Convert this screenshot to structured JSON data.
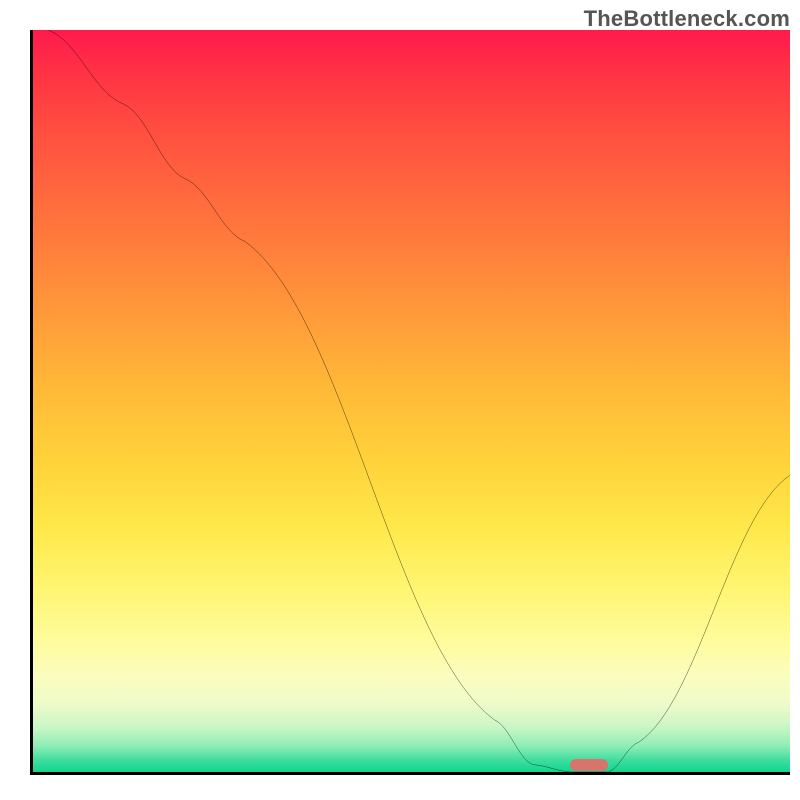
{
  "watermark": "TheBottleneck.com",
  "chart_data": {
    "type": "line",
    "title": "",
    "xlabel": "",
    "ylabel": "",
    "xlim": [
      0,
      100
    ],
    "ylim": [
      0,
      100
    ],
    "gradient_stops": [
      {
        "pos": 0,
        "color": "#ff1a4d"
      },
      {
        "pos": 6,
        "color": "#ff3344"
      },
      {
        "pos": 14,
        "color": "#ff5040"
      },
      {
        "pos": 28,
        "color": "#ff7a3c"
      },
      {
        "pos": 38,
        "color": "#ff993a"
      },
      {
        "pos": 48,
        "color": "#ffb838"
      },
      {
        "pos": 58,
        "color": "#ffd23a"
      },
      {
        "pos": 67,
        "color": "#ffe84a"
      },
      {
        "pos": 75,
        "color": "#fff570"
      },
      {
        "pos": 82,
        "color": "#fefc9a"
      },
      {
        "pos": 87,
        "color": "#fcfdbe"
      },
      {
        "pos": 91,
        "color": "#edfbc9"
      },
      {
        "pos": 94,
        "color": "#c9f6c5"
      },
      {
        "pos": 96.5,
        "color": "#8eedb6"
      },
      {
        "pos": 98.5,
        "color": "#3bdd9d"
      },
      {
        "pos": 100,
        "color": "#12d48e"
      }
    ],
    "series": [
      {
        "name": "bottleneck-curve",
        "x": [
          2,
          12,
          20,
          28,
          61,
          66,
          71,
          76,
          80,
          100
        ],
        "y": [
          100,
          90,
          80,
          71.5,
          7,
          1,
          0,
          0,
          4,
          40
        ]
      }
    ],
    "minimum_marker": {
      "x_start": 71,
      "x_end": 76,
      "y": 0,
      "color": "#d9746c"
    }
  }
}
